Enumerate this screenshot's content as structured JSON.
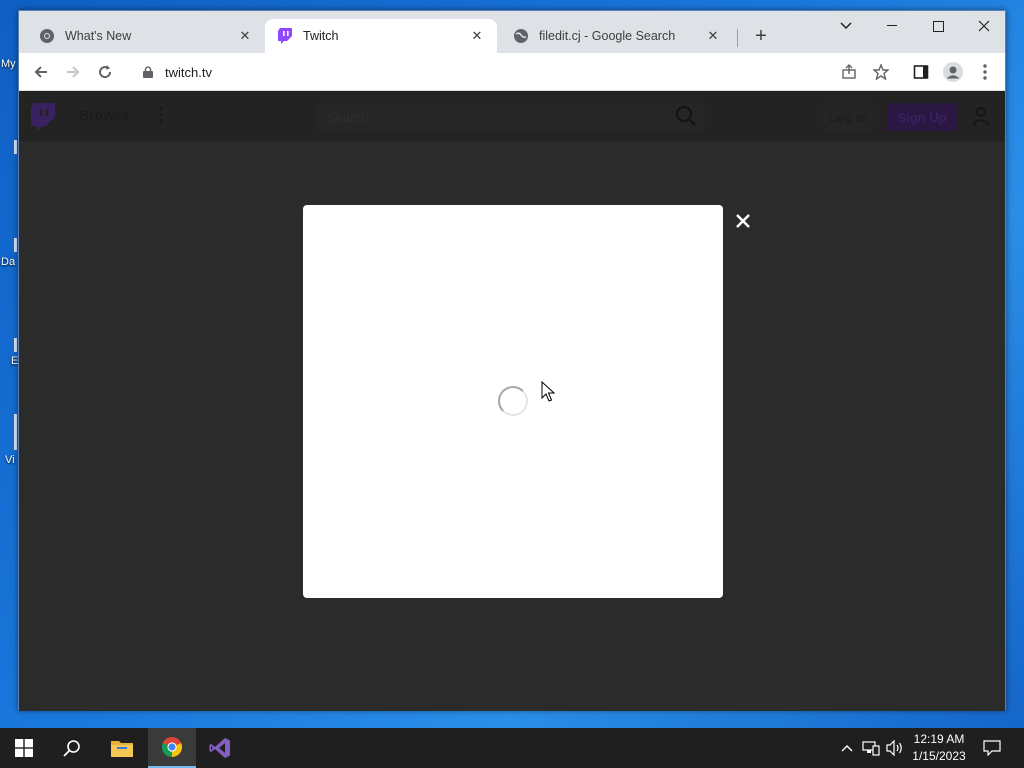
{
  "desktop": {
    "labels": [
      "My",
      "Da",
      "E",
      "Vi"
    ]
  },
  "browser": {
    "tabs": [
      {
        "title": "What's New",
        "icon": "chrome-icon"
      },
      {
        "title": "Twitch",
        "icon": "twitch-icon",
        "active": true
      },
      {
        "title": "filedit.cj - Google Search",
        "icon": "globe-icon"
      }
    ],
    "url": "twitch.tv"
  },
  "twitch": {
    "browse_label": "Browse",
    "search_placeholder": "Search",
    "login_label": "Log In",
    "signup_label": "Sign Up",
    "brand_color": "#9146ff"
  },
  "modal": {
    "state": "loading"
  },
  "taskbar": {
    "time": "12:19 AM",
    "date": "1/15/2023",
    "apps": [
      "start",
      "search",
      "file-explorer",
      "chrome",
      "visual-studio"
    ]
  }
}
